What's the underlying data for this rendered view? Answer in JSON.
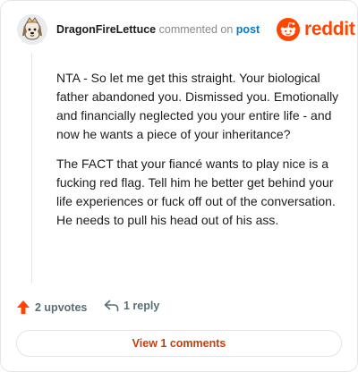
{
  "comment": {
    "author": "DragonFireLettuce",
    "action": "commented on",
    "target": "post",
    "avatar_icon": "cartoon-dog-avatar",
    "body": [
      "NTA - So let me get this straight. Your biological father abandoned you. Dismissed you. Emotionally and financially neglected you your entire life - and now he wants a piece of your inheritance?",
      "The FACT that your fiancé wants to play nice is a fucking red flag. Tell him he better get behind your life experiences or fuck off out of the conversation. He needs to pull his head out of his ass."
    ]
  },
  "brand": {
    "name": "reddit",
    "icon": "reddit-snoo-icon",
    "color": "#ff4500"
  },
  "actions": {
    "upvotes": "2 upvotes",
    "upvote_icon": "upvote-arrow-icon",
    "upvote_color": "#ff4500",
    "replies": "1 reply",
    "reply_icon": "reply-arrow-icon"
  },
  "view_button": {
    "label": "View 1 comments"
  }
}
